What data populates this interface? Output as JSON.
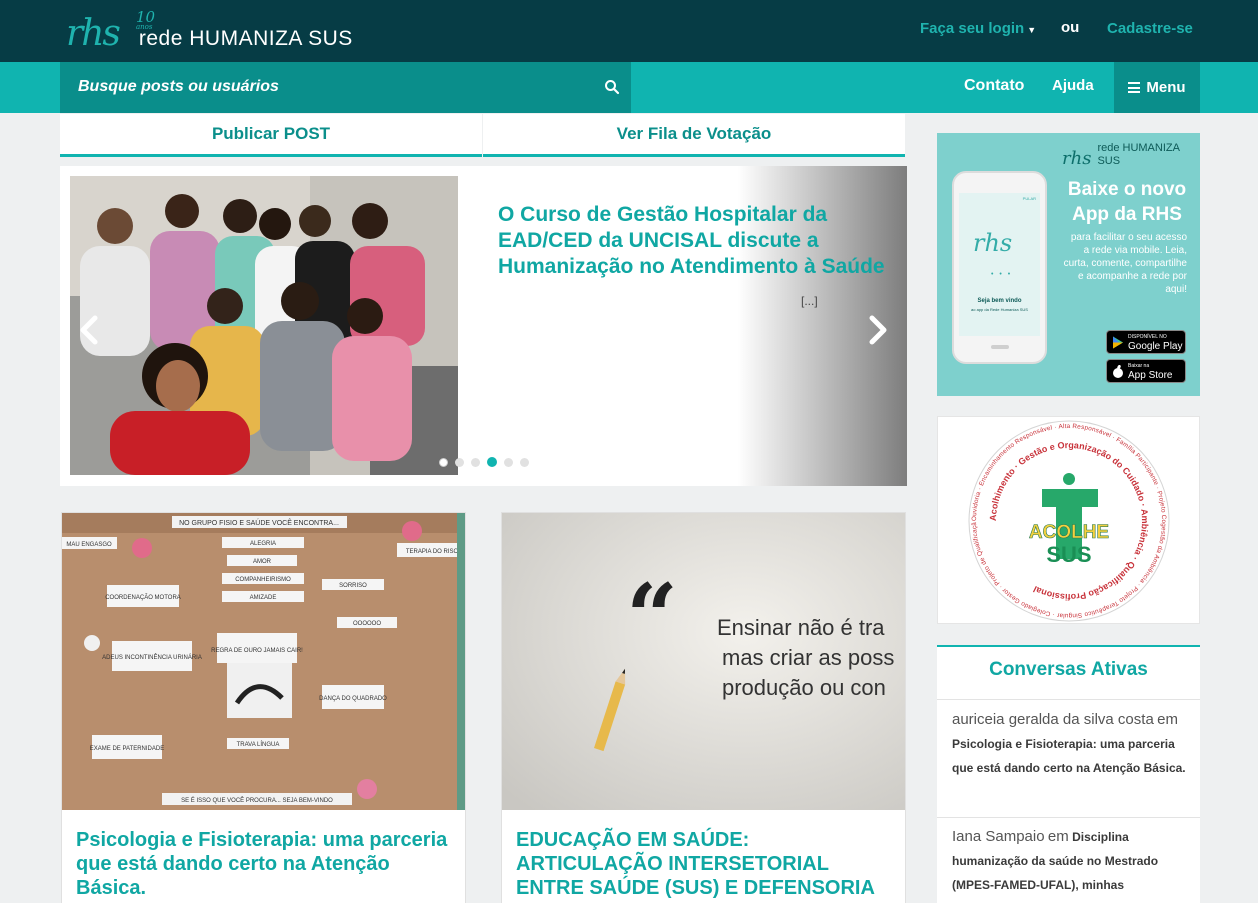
{
  "header": {
    "logo_mark": "rhs",
    "logo_years": "10",
    "logo_years_label": "anos",
    "logo_name": "rede HUMANIZA SUS",
    "login_label": "Faça seu login",
    "or_label": "ou",
    "register_label": "Cadastre-se"
  },
  "nav": {
    "search_placeholder": "Busque posts ou usuários",
    "contato": "Contato",
    "ajuda": "Ajuda",
    "menu": "Menu"
  },
  "tabs": {
    "publicar": "Publicar POST",
    "fila": "Ver Fila de Votação"
  },
  "carousel": {
    "title": "O Curso de Gestão Hospitalar da EAD/CED da UNCISAL discute a Humanização no Atendimento à Saúde",
    "more": "[...]",
    "dot_count": 6,
    "active_dot": 4
  },
  "cards": [
    {
      "title": "Psicologia e Fisioterapia: uma parceria que está dando certo na Atenção Básica.",
      "board_header": "NO GRUPO FISIO E SAÚDE VOCÊ ENCONTRA...",
      "board_footer": "SE É ISSO QUE VOCÊ PROCURA... SEJA BEM-VINDO",
      "board_labels": [
        "ALEGRIA",
        "AMOR",
        "COMPANHEIRISMO",
        "AMIZADE",
        "SORRISO",
        "COORDENAÇÃO MOTORA",
        "ADEUS INCONTINÊNCIA URINÁRIA",
        "REGRA DE OURO JAMAIS CAIR!",
        "DANÇA DO QUADRADO",
        "EXAME DE PATERNIDADE",
        "TRAVA LÍNGUA",
        "TERAPIA DO RISO",
        "MAU ENGASGO",
        "OOOOOO"
      ]
    },
    {
      "title": "EDUCAÇÃO EM SAÚDE: ARTICULAÇÃO INTERSETORIAL ENTRE SAÚDE (SUS) E DEFENSORIA PUBLICA",
      "quote_lines": [
        "Ensinar não é tra",
        "mas criar as poss",
        "produção ou con"
      ]
    }
  ],
  "app_banner": {
    "logo_mark": "rhs",
    "logo_name": "rede HUMANIZA SUS",
    "heading": "Baixe o novo App da RHS",
    "description": "para facilitar o seu acesso a rede via mobile. Leia, curta, comente, compartilhe e acompanhe a rede por aqui!",
    "phone_logo": "rhs",
    "phone_welcome": "Seja bem vindo",
    "phone_sub": "ao app da Rede Humaniza SUS",
    "phone_skip": "PULAR",
    "google_small": "DISPONÍVEL NO",
    "google_big": "Google Play",
    "apple_small": "Baixar na",
    "apple_big": "App Store"
  },
  "acolhe": {
    "center_top": "ACOLHE",
    "center_bottom": "SUS",
    "ring_text": "Ouvidoria · Encaminhamento Responsável · Alta Responsável · Família Participante · Projeto Cogestão da Ambiência · Projeto Terapêutico Singular · Colegiado Gestor · Projeto de Qualificação e Educação Permanente",
    "inner_ring_text": "Acolhimento · Gestão e Organização do Cuidado · Ambiência · Qualificação Profissional"
  },
  "conversas": {
    "title": "Conversas Ativas",
    "items": [
      {
        "user": "auriceia geralda da silva costa",
        "em": "em",
        "post": "Psicologia e Fisioterapia: uma parceria que está dando certo na Atenção Básica."
      },
      {
        "user": "Iana Sampaio",
        "em": "em",
        "post": "Disciplina humanização da saúde no Mestrado (MPES-FAMED-UFAL), minhas"
      }
    ]
  },
  "colors": {
    "top_bar": "#063c45",
    "accent": "#10b4b0",
    "accent_dark": "#0a8e8b",
    "link": "#10a7a3"
  }
}
